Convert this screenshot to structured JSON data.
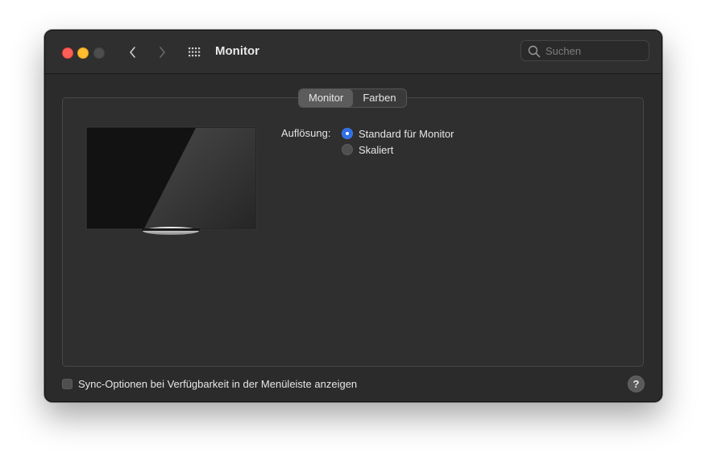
{
  "window": {
    "title": "Monitor"
  },
  "toolbar": {
    "back_icon": "chevron-left-icon",
    "forward_icon": "chevron-right-icon",
    "grid_icon": "grid-icon"
  },
  "search": {
    "placeholder": "Suchen",
    "value": ""
  },
  "tabs": [
    {
      "label": "Monitor",
      "active": true
    },
    {
      "label": "Farben",
      "active": false
    }
  ],
  "resolution": {
    "label": "Auflösung:",
    "options": [
      {
        "label": "Standard für Monitor",
        "selected": true
      },
      {
        "label": "Skaliert",
        "selected": false
      }
    ]
  },
  "footer": {
    "sync_label": "Sync-Optionen bei Verfügbarkeit in der Menüleiste anzeigen",
    "sync_checked": false,
    "help_label": "?"
  },
  "colors": {
    "accent": "#2f6fe6",
    "close": "#ff5f57",
    "minimize": "#febc2e"
  }
}
